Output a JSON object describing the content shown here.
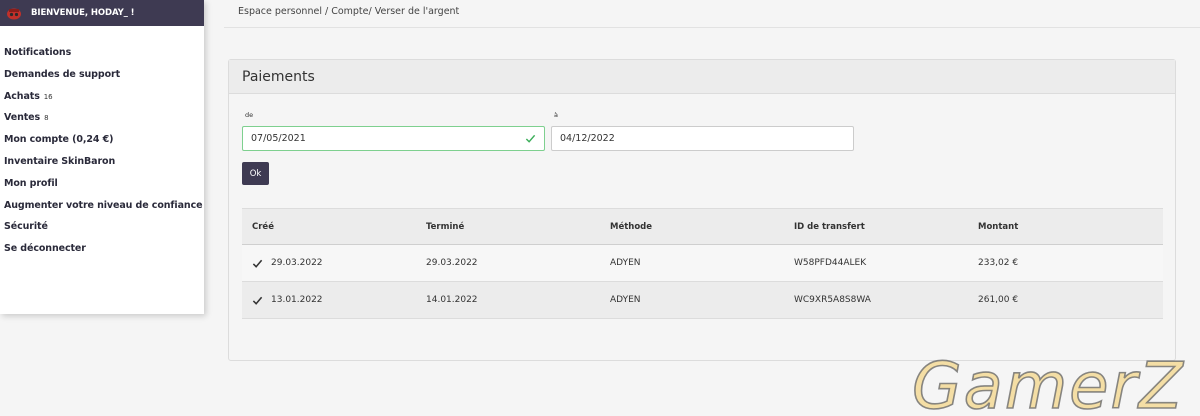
{
  "sidebar": {
    "welcome": "BIENVENUE, HODAY_ !",
    "items": [
      {
        "label": "Notifications"
      },
      {
        "label": "Demandes de support"
      },
      {
        "label": "Achats",
        "badge": "16"
      },
      {
        "label": "Ventes",
        "badge": "8"
      },
      {
        "label": "Mon compte (0,24 €)"
      },
      {
        "label": "Inventaire SkinBaron"
      },
      {
        "label": "Mon profil"
      },
      {
        "label": "Augmenter votre niveau de confiance"
      },
      {
        "label": "Sécurité"
      },
      {
        "label": "Se déconnecter"
      }
    ]
  },
  "breadcrumb": "Espace personnel / Compte/ Verser de l'argent",
  "panel": {
    "title": "Paiements",
    "from_label": "de",
    "from_value": "07/05/2021",
    "to_label": "à",
    "to_value": "04/12/2022",
    "ok_label": "Ok"
  },
  "table": {
    "headers": [
      "Créé",
      "Terminé",
      "Méthode",
      "ID de transfert",
      "Montant"
    ],
    "rows": [
      {
        "created": "29.03.2022",
        "finished": "29.03.2022",
        "method": "ADYEN",
        "transfer_id": "W58PFD44ALEK",
        "amount": "233,02 €"
      },
      {
        "created": "13.01.2022",
        "finished": "14.01.2022",
        "method": "ADYEN",
        "transfer_id": "WC9XR5A8S8WA",
        "amount": "261,00 €"
      }
    ]
  },
  "watermark": "GamerZ",
  "colors": {
    "sidebar_header": "#3e3a52",
    "valid_border": "#7ed08f",
    "watermark": "#f3d68a"
  }
}
